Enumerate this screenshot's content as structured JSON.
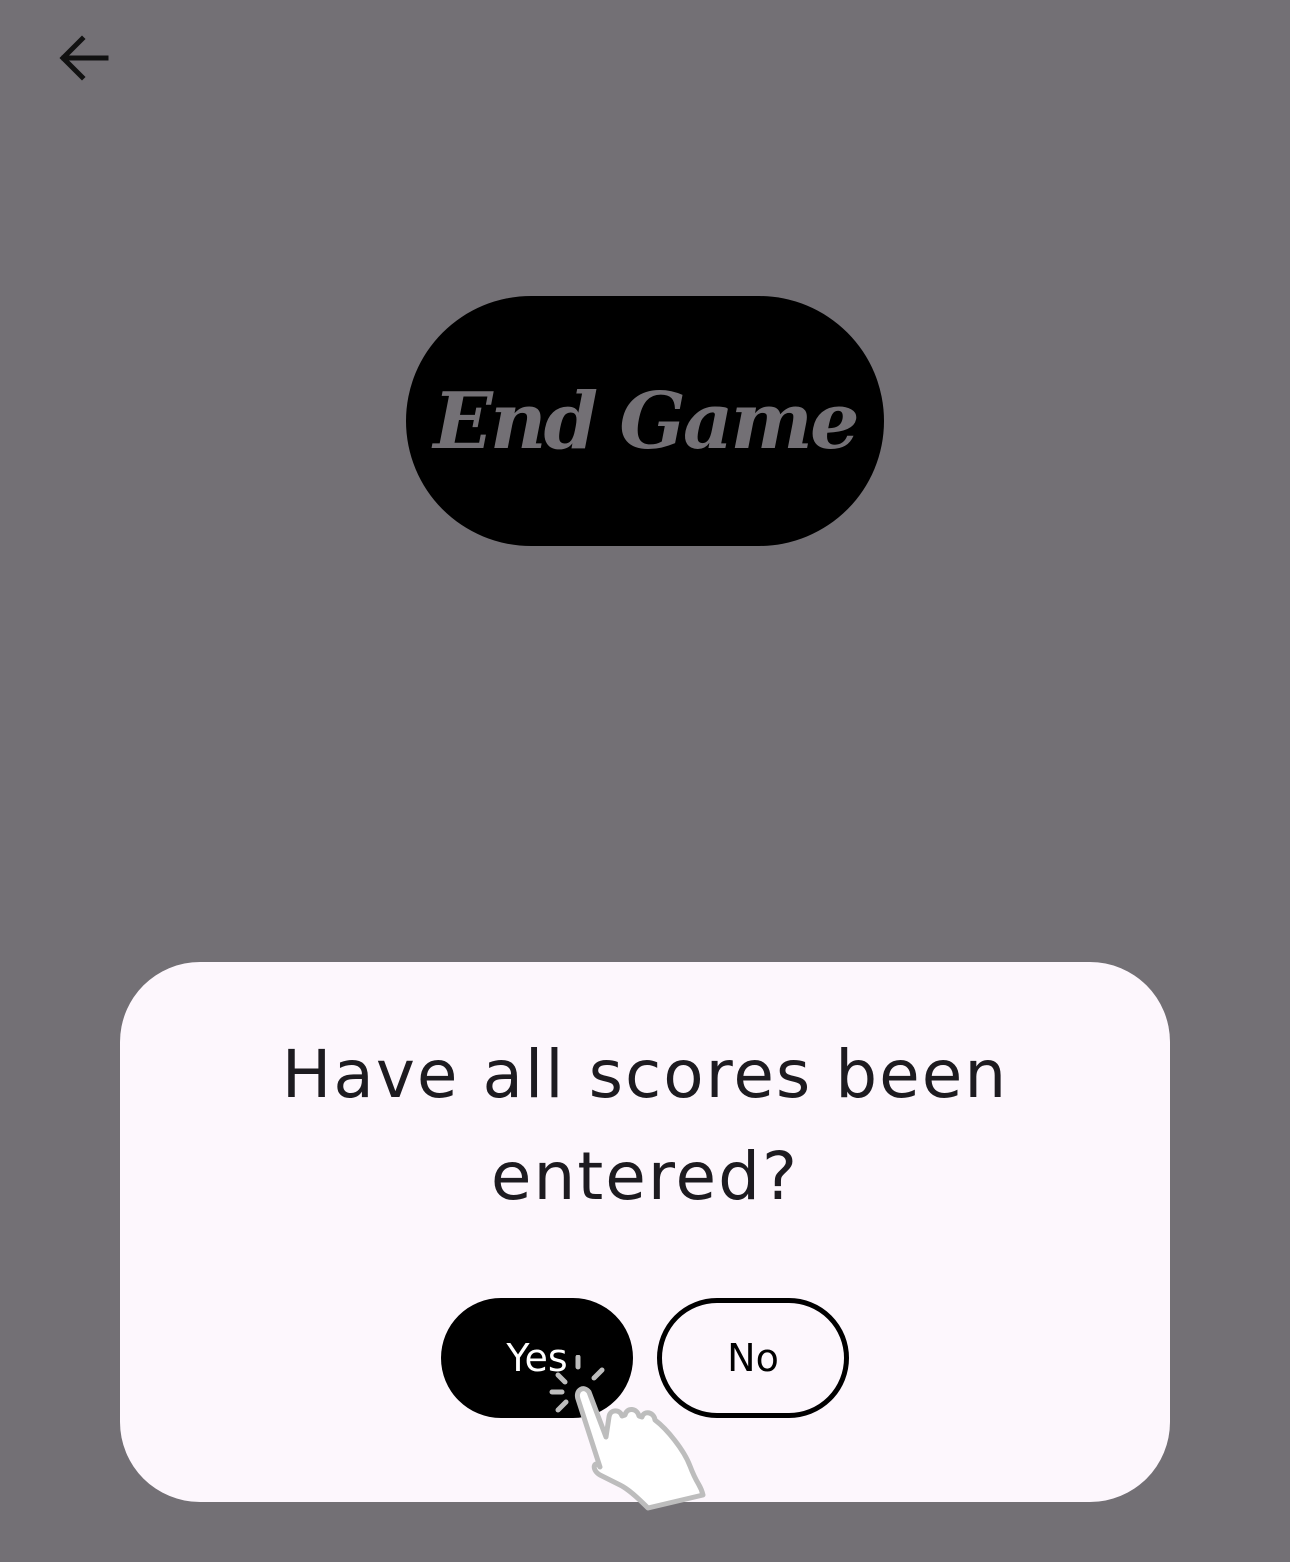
{
  "colors": {
    "scrim_background": "#737075",
    "end_game_button_bg": "#000000",
    "end_game_button_text": "#737075",
    "dialog_bg": "#fdf7fd",
    "dialog_text": "#1d1b20",
    "primary_button_bg": "#000000",
    "primary_button_text": "#ffffff",
    "outline_button_border": "#000000"
  },
  "toolbar": {
    "back_icon": "arrow-left-icon"
  },
  "main": {
    "end_game_label": "End Game"
  },
  "dialog": {
    "message": "Have all scores been entered?",
    "yes_label": "Yes",
    "no_label": "No"
  },
  "overlay": {
    "pointer_icon": "tap-hand-icon"
  }
}
